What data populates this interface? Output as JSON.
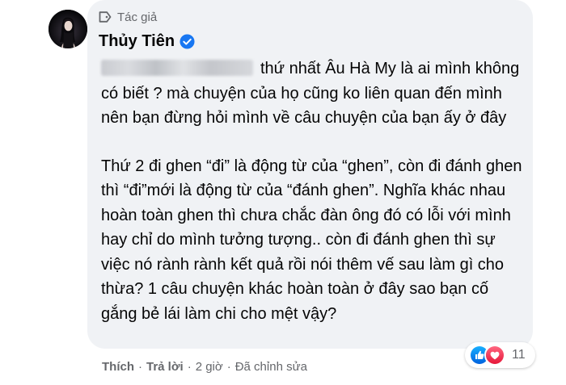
{
  "author": {
    "badge_label": "Tác giả",
    "name": "Thủy Tiên"
  },
  "comment": {
    "paragraph1": "thứ nhất Âu Hà My là ai mình không có biết ? mà chuyện của họ cũng ko liên quan đến mình nên bạn đừng hỏi mình về câu chuyện của bạn ấy ở đây",
    "paragraph2": "Thứ 2 đi ghen “đi” là động từ của “ghen”, còn đi đánh ghen thì “đi”mới là động từ của “đánh ghen”. Nghĩa khác nhau hoàn toàn ghen thì chưa chắc đàn ông đó có lỗi với mình hay chỉ do mình tưởng tượng.. còn đi đánh ghen thì sự việc nó rành rành kết quả rồi nói thêm vế sau làm gì cho thừa? 1 câu chuyện khác hoàn toàn ở đây sao bạn cố gắng bẻ lái làm chi cho mệt vậy?"
  },
  "reactions": {
    "types": [
      "like-icon",
      "love-icon"
    ],
    "count": "11",
    "like_color": "#1877f2",
    "love_color": "#f33e58"
  },
  "actions": {
    "like_label": "Thích",
    "reply_label": "Trả lời",
    "separator": "·",
    "time": "2 giờ",
    "edited_label": "Đã chỉnh sửa"
  },
  "colors": {
    "bubble_bg": "#f0f2f5",
    "text": "#050505",
    "secondary_text": "#65676b",
    "verified": "#1877f2"
  }
}
